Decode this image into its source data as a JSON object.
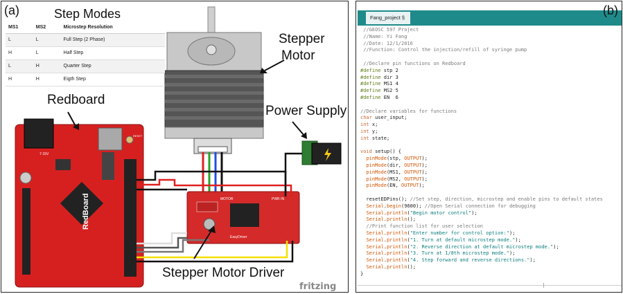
{
  "panel_a": {
    "label": "(a)",
    "step_modes": {
      "title": "Step Modes",
      "headers": [
        "MS1",
        "MS2",
        "Microstep Resolution"
      ],
      "rows": [
        [
          "L",
          "L",
          "Full Step (2 Phase)"
        ],
        [
          "H",
          "L",
          "Half Step"
        ],
        [
          "L",
          "H",
          "Quarter Step"
        ],
        [
          "H",
          "H",
          "Eigth Step"
        ]
      ]
    },
    "labels": {
      "redboard": "Redboard",
      "stepper_motor_line1": "Stepper",
      "stepper_motor_line2": "Motor",
      "power_supply": "Power Supply",
      "stepper_motor_driver": "Stepper Motor Driver",
      "fritzing": "fritzing",
      "board_brand": "RedBoard",
      "board_power": "7-15V",
      "board_reset": "RESET",
      "driver_name": "EasyDriver",
      "driver_motor": "MOTOR",
      "driver_power": "PWR IN"
    },
    "colors": {
      "board_red": "#d62020",
      "driver_red": "#d42a2a",
      "power_green": "#2e7d32",
      "wire_black": "#111111",
      "wire_red": "#e02020",
      "wire_green": "#2aa02a",
      "wire_blue": "#2050e0",
      "wire_yellow": "#f5e000",
      "wire_white": "#dddddd"
    }
  },
  "panel_b": {
    "label": "(b)",
    "tab_label": "Fang_project §",
    "accent": "#1f8a8a",
    "code_lines": [
      " //GEOSC 597 Project",
      " //Name: Yi Fang",
      " //Date: 12/1/2016",
      " //Function: Control the injection/refill of syringe pump",
      "",
      " //Declare pin functions on Redboard",
      "#define stp 2",
      "#define dir 3",
      "#define MS1 4",
      "#define MS2 5",
      "#define EN  6",
      "",
      "//Declare variables for functions",
      "char user_input;",
      "int x;",
      "int y;",
      "int state;",
      "",
      "void setup() {",
      "  pinMode(stp, OUTPUT);",
      "  pinMode(dir, OUTPUT);",
      "  pinMode(MS1, OUTPUT);",
      "  pinMode(MS2, OUTPUT);",
      "  pinMode(EN, OUTPUT);",
      "",
      "  resetEDPins(); //Set step, direction, microstep and enable pins to default states",
      "  Serial.begin(9600); //Open Serial connection for debugging",
      "  Serial.println(\"Begin motor control\");",
      "  Serial.println();",
      "  //Print function list for user selection",
      "  Serial.println(\"Enter number for control option:\");",
      "  Serial.println(\"1. Turn at default microstep mode.\");",
      "  Serial.println(\"2. Reverse direction at default microstep mode.\");",
      "  Serial.println(\"3. Turn at 1/8th microstep mode.\");",
      "  Serial.println(\"4. Step forward and reverse directions.\");",
      "  Serial.println();",
      "}"
    ]
  }
}
